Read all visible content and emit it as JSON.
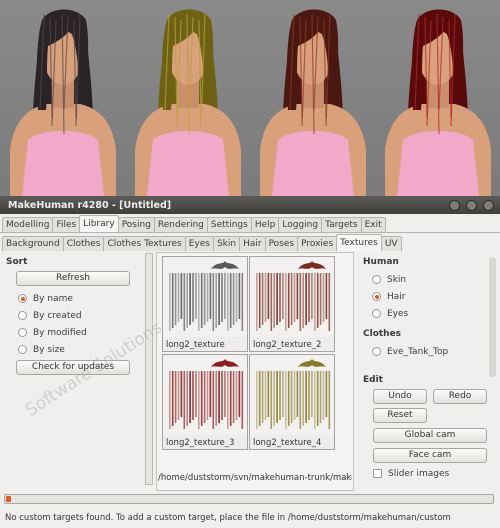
{
  "window": {
    "title": "MakeHuman r4280 - [Untitled]",
    "controls": [
      "window-minimize",
      "window-maximize",
      "window-close"
    ]
  },
  "main_tabs": [
    {
      "label": "Modelling",
      "active": false
    },
    {
      "label": "Files",
      "active": false
    },
    {
      "label": "Library",
      "active": true
    },
    {
      "label": "Posing",
      "active": false
    },
    {
      "label": "Rendering",
      "active": false
    },
    {
      "label": "Settings",
      "active": false
    },
    {
      "label": "Help",
      "active": false
    },
    {
      "label": "Logging",
      "active": false
    },
    {
      "label": "Targets",
      "active": false
    },
    {
      "label": "Exit",
      "active": false
    }
  ],
  "sub_tabs": [
    {
      "label": "Background",
      "active": false
    },
    {
      "label": "Clothes",
      "active": false
    },
    {
      "label": "Clothes Textures",
      "active": false
    },
    {
      "label": "Eyes",
      "active": false
    },
    {
      "label": "Skin",
      "active": false
    },
    {
      "label": "Hair",
      "active": false
    },
    {
      "label": "Poses",
      "active": false
    },
    {
      "label": "Proxies",
      "active": false
    },
    {
      "label": "Textures",
      "active": true
    },
    {
      "label": "UV",
      "active": false
    }
  ],
  "sort": {
    "title": "Sort",
    "refresh_label": "Refresh",
    "options": [
      {
        "label": "By name",
        "selected": true
      },
      {
        "label": "By created",
        "selected": false
      },
      {
        "label": "By modified",
        "selected": false
      },
      {
        "label": "By size",
        "selected": false
      }
    ],
    "updates_label": "Check for updates"
  },
  "textures": [
    {
      "label": "long2_texture",
      "color": "#5a5a5a"
    },
    {
      "label": "long2_texture_2",
      "color": "#7a2e20"
    },
    {
      "label": "long2_texture_3",
      "color": "#8a1e1e"
    },
    {
      "label": "long2_texture_4",
      "color": "#8a7a2a"
    }
  ],
  "path": "/home/duststorm/svn/makehuman-trunk/makehu",
  "human": {
    "title": "Human",
    "options": [
      {
        "label": "Skin",
        "selected": false
      },
      {
        "label": "Hair",
        "selected": true
      },
      {
        "label": "Eyes",
        "selected": false
      }
    ]
  },
  "clothes": {
    "title": "Clothes",
    "options": [
      {
        "label": "Eve_Tank_Top",
        "selected": false
      }
    ]
  },
  "edit": {
    "title": "Edit",
    "undo_label": "Undo",
    "redo_label": "Redo",
    "reset_label": "Reset",
    "global_cam_label": "Global cam",
    "face_cam_label": "Face cam",
    "slider_images_label": "Slider images"
  },
  "watermark": "Software Solutions",
  "status": "No custom targets found. To add a custom target, place the file in /home/duststorm/makehuman/custom",
  "progress_fraction": 0.01,
  "colors": {
    "accent": "#e05a1f",
    "skin": "#d9a07c",
    "top": "#f2a8c8"
  },
  "models": [
    {
      "hair": "#2a2426",
      "highlight": "#554a4c"
    },
    {
      "hair": "#6e6114",
      "highlight": "#b6a33a"
    },
    {
      "hair": "#4a1810",
      "highlight": "#8e3a28"
    },
    {
      "hair": "#5a0a0a",
      "highlight": "#b02828"
    }
  ]
}
